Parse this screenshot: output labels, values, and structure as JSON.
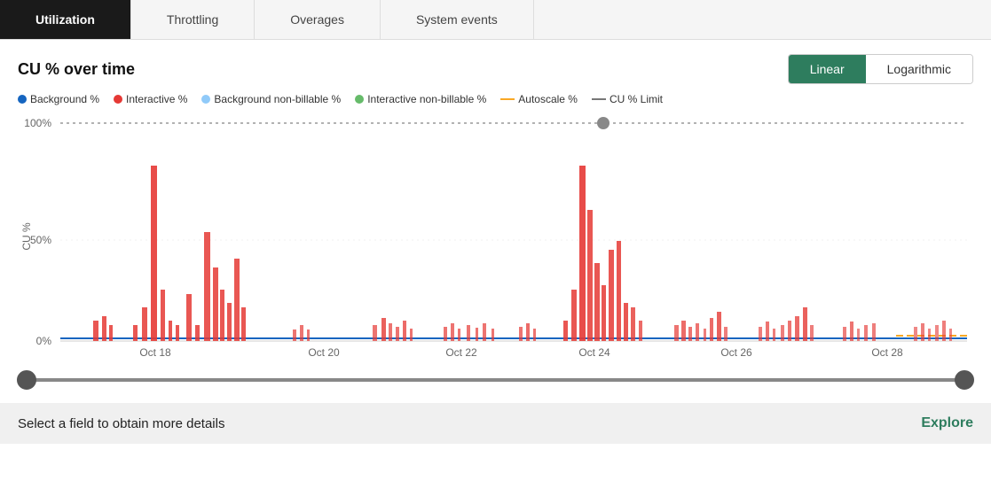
{
  "tabs": [
    {
      "label": "Utilization",
      "active": true
    },
    {
      "label": "Throttling",
      "active": false
    },
    {
      "label": "Overages",
      "active": false
    },
    {
      "label": "System events",
      "active": false
    }
  ],
  "chart": {
    "title": "CU % over time",
    "scale_linear": "Linear",
    "scale_logarithmic": "Logarithmic",
    "active_scale": "linear",
    "y_labels": [
      "100%",
      "50%",
      "0%"
    ],
    "x_labels": [
      "Oct 18",
      "Oct 20",
      "Oct 22",
      "Oct 24",
      "Oct 26",
      "Oct 28"
    ]
  },
  "legend": [
    {
      "label": "Background %",
      "type": "dot",
      "color": "#1565c0"
    },
    {
      "label": "Interactive %",
      "type": "dot",
      "color": "#e53935"
    },
    {
      "label": "Background non-billable %",
      "type": "dot",
      "color": "#90caf9"
    },
    {
      "label": "Interactive non-billable %",
      "type": "dot",
      "color": "#66bb6a"
    },
    {
      "label": "Autoscale %",
      "type": "dash",
      "color": "#f9a825"
    },
    {
      "label": "CU % Limit",
      "type": "dash",
      "color": "#777"
    }
  ],
  "footer": {
    "text": "Select a field to obtain more details",
    "explore_label": "Explore"
  }
}
